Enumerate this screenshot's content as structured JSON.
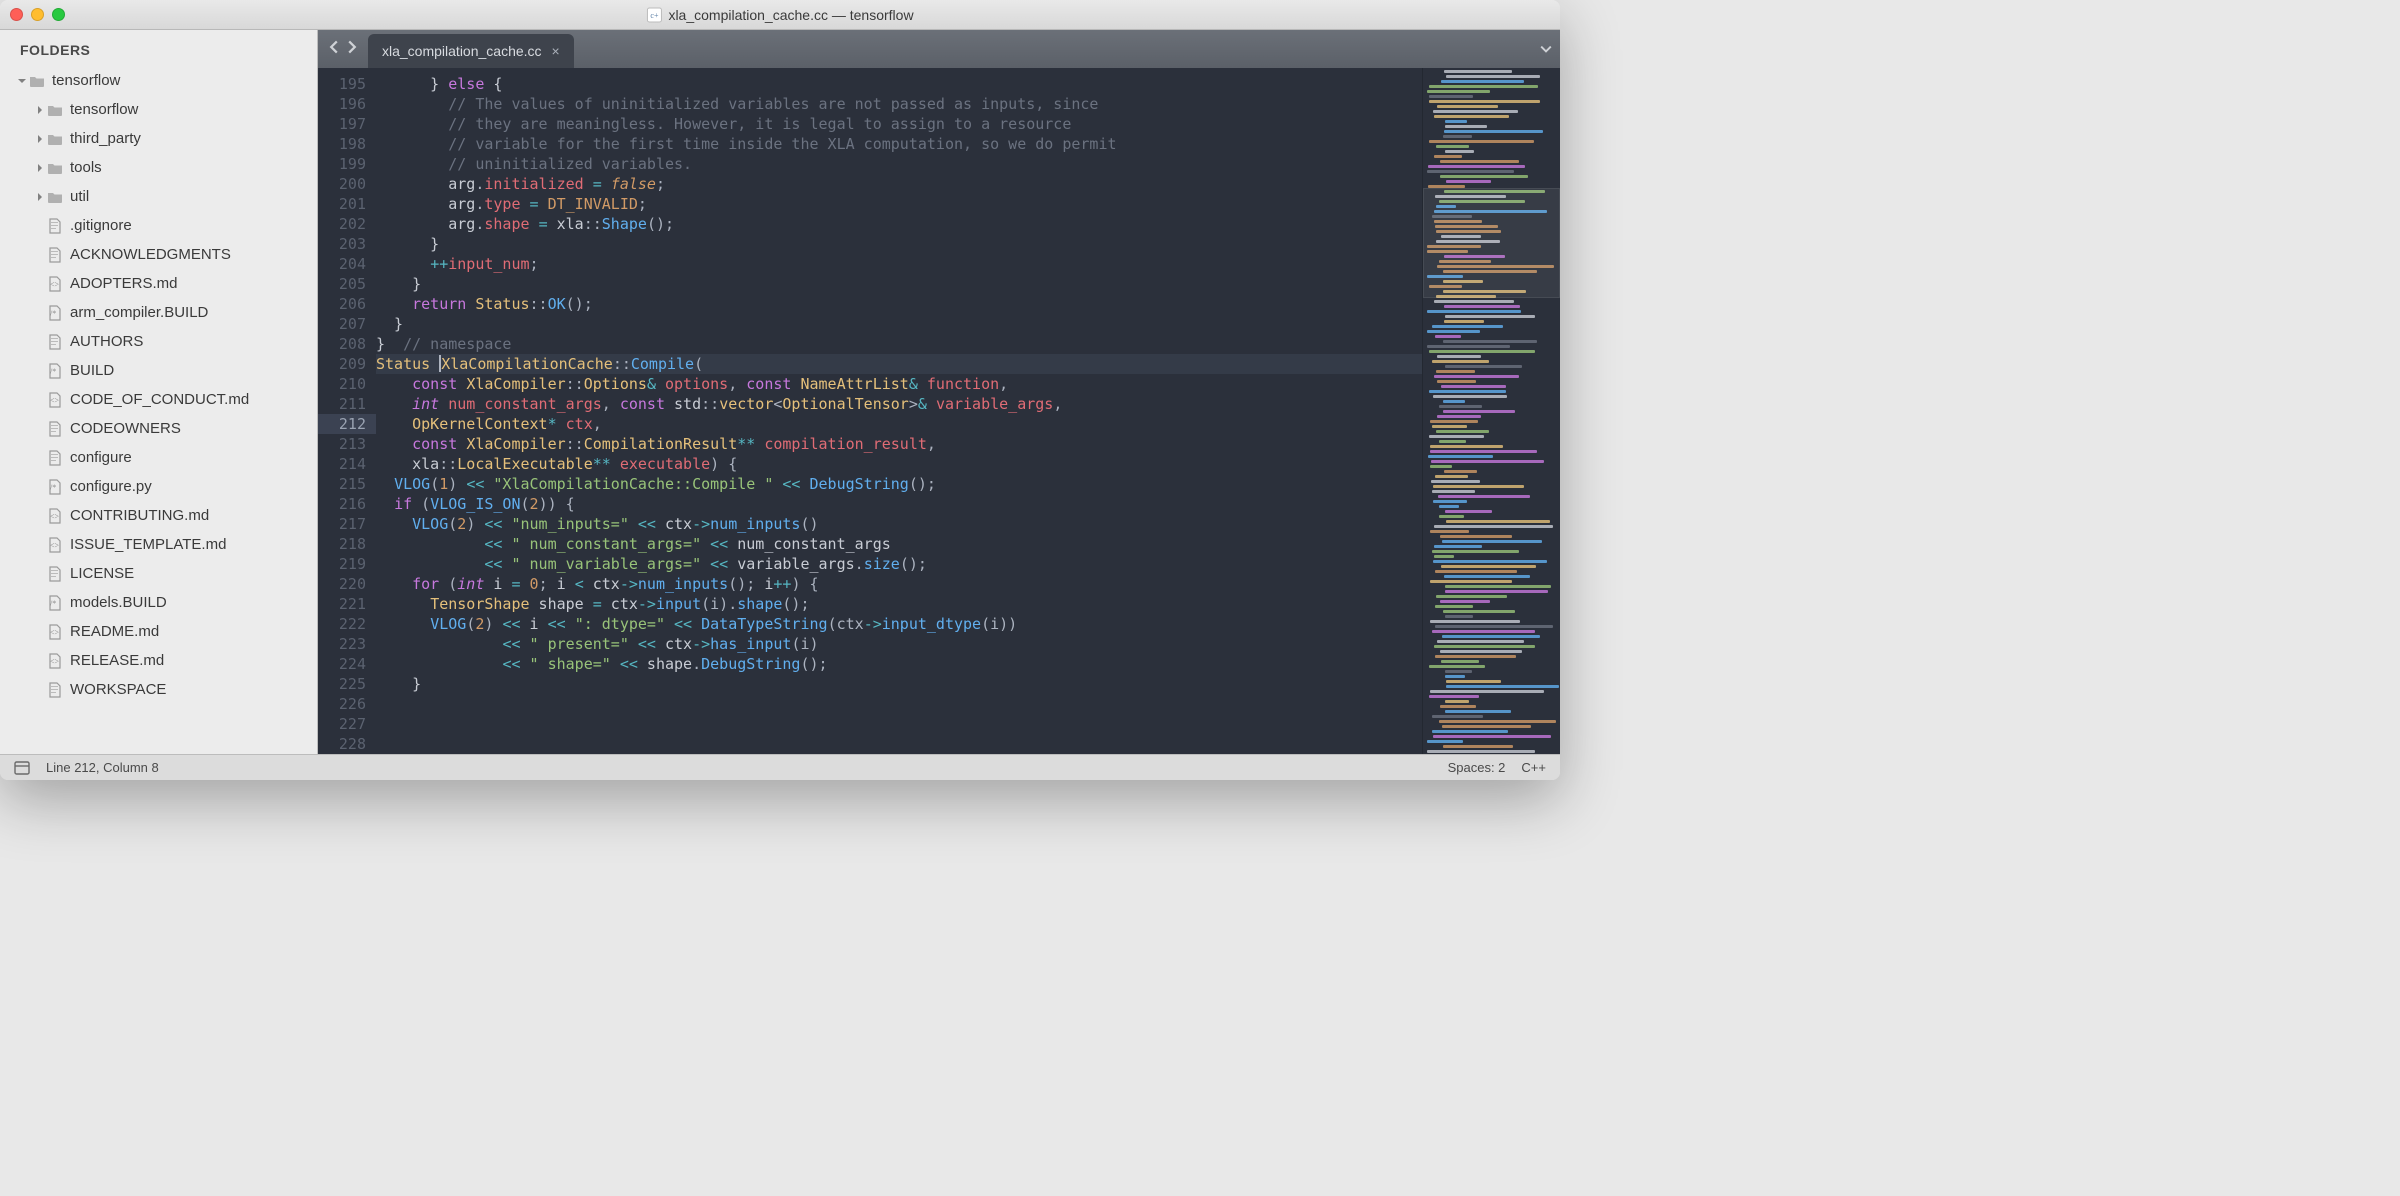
{
  "window": {
    "title": "xla_compilation_cache.cc — tensorflow"
  },
  "sidebar": {
    "header": "FOLDERS",
    "root": {
      "label": "tensorflow",
      "expanded": true,
      "folders": [
        {
          "label": "tensorflow"
        },
        {
          "label": "third_party"
        },
        {
          "label": "tools"
        },
        {
          "label": "util"
        }
      ],
      "files": [
        {
          "label": ".gitignore",
          "icon": "file"
        },
        {
          "label": "ACKNOWLEDGMENTS",
          "icon": "file"
        },
        {
          "label": "ADOPTERS.md",
          "icon": "md"
        },
        {
          "label": "arm_compiler.BUILD",
          "icon": "code"
        },
        {
          "label": "AUTHORS",
          "icon": "file"
        },
        {
          "label": "BUILD",
          "icon": "code"
        },
        {
          "label": "CODE_OF_CONDUCT.md",
          "icon": "md"
        },
        {
          "label": "CODEOWNERS",
          "icon": "file"
        },
        {
          "label": "configure",
          "icon": "file"
        },
        {
          "label": "configure.py",
          "icon": "code"
        },
        {
          "label": "CONTRIBUTING.md",
          "icon": "md"
        },
        {
          "label": "ISSUE_TEMPLATE.md",
          "icon": "md"
        },
        {
          "label": "LICENSE",
          "icon": "file"
        },
        {
          "label": "models.BUILD",
          "icon": "code"
        },
        {
          "label": "README.md",
          "icon": "md"
        },
        {
          "label": "RELEASE.md",
          "icon": "md"
        },
        {
          "label": "WORKSPACE",
          "icon": "file"
        }
      ]
    }
  },
  "tabs": {
    "active": {
      "label": "xla_compilation_cache.cc"
    }
  },
  "editor": {
    "first_line": 195,
    "highlight_line": 212,
    "lines": [
      [
        [
          "      } "
        ],
        [
          "kw",
          "else"
        ],
        [
          " {"
        ]
      ],
      [
        [
          "        "
        ],
        [
          "comm",
          "// The values of uninitialized variables are not passed as inputs, since"
        ]
      ],
      [
        [
          "        "
        ],
        [
          "comm",
          "// they are meaningless. However, it is legal to assign to a resource"
        ]
      ],
      [
        [
          "        "
        ],
        [
          "comm",
          "// variable for the first time inside the XLA computation, so we do permit"
        ]
      ],
      [
        [
          "        "
        ],
        [
          "comm",
          "// uninitialized variables."
        ]
      ],
      [
        [
          "        arg"
        ],
        [
          "punc",
          "."
        ],
        [
          "var",
          "initialized"
        ],
        [
          " "
        ],
        [
          "op",
          "="
        ],
        [
          " "
        ],
        [
          "boolf",
          "false"
        ],
        [
          "punc",
          ";"
        ]
      ],
      [
        [
          "        arg"
        ],
        [
          "punc",
          "."
        ],
        [
          "var",
          "type"
        ],
        [
          " "
        ],
        [
          "op",
          "="
        ],
        [
          " "
        ],
        [
          "const",
          "DT_INVALID"
        ],
        [
          "punc",
          ";"
        ]
      ],
      [
        [
          "        arg"
        ],
        [
          "punc",
          "."
        ],
        [
          "var",
          "shape"
        ],
        [
          " "
        ],
        [
          "op",
          "="
        ],
        [
          " xla"
        ],
        [
          "punc",
          "::"
        ],
        [
          "fn",
          "Shape"
        ],
        [
          "punc",
          "();"
        ]
      ],
      [
        [
          "      }"
        ]
      ],
      [
        [
          "      "
        ],
        [
          "op",
          "++"
        ],
        [
          "var",
          "input_num"
        ],
        [
          "punc",
          ";"
        ]
      ],
      [
        [
          "    }"
        ]
      ],
      [
        [
          ""
        ]
      ],
      [
        [
          "    "
        ],
        [
          "kw",
          "return"
        ],
        [
          " "
        ],
        [
          "cls",
          "Status"
        ],
        [
          "punc",
          "::"
        ],
        [
          "fn",
          "OK"
        ],
        [
          "punc",
          "();"
        ]
      ],
      [
        [
          "  }"
        ]
      ],
      [
        [
          ""
        ]
      ],
      [
        [
          "}  "
        ],
        [
          "comm",
          "// namespace"
        ]
      ],
      [
        [
          ""
        ]
      ],
      [
        [
          "cls",
          "Status"
        ],
        [
          " "
        ],
        [
          "CURSOR"
        ],
        [
          "cls",
          "XlaCompilationCache"
        ],
        [
          "punc",
          "::"
        ],
        [
          "fn",
          "Compile"
        ],
        [
          "punc",
          "("
        ]
      ],
      [
        [
          "    "
        ],
        [
          "kw",
          "const"
        ],
        [
          " "
        ],
        [
          "cls",
          "XlaCompiler"
        ],
        [
          "punc",
          "::"
        ],
        [
          "cls",
          "Options"
        ],
        [
          "op",
          "&"
        ],
        [
          " "
        ],
        [
          "var",
          "options"
        ],
        [
          "punc",
          ", "
        ],
        [
          "kw",
          "const"
        ],
        [
          " "
        ],
        [
          "cls",
          "NameAttrList"
        ],
        [
          "op",
          "&"
        ],
        [
          " "
        ],
        [
          "var",
          "function"
        ],
        [
          "punc",
          ","
        ]
      ],
      [
        [
          "    "
        ],
        [
          "type",
          "int"
        ],
        [
          " "
        ],
        [
          "var",
          "num_constant_args"
        ],
        [
          "punc",
          ", "
        ],
        [
          "kw",
          "const"
        ],
        [
          " std"
        ],
        [
          "punc",
          "::"
        ],
        [
          "cls",
          "vector"
        ],
        [
          "punc",
          "<"
        ],
        [
          "cls",
          "OptionalTensor"
        ],
        [
          "punc",
          ">"
        ],
        [
          "op",
          "&"
        ],
        [
          " "
        ],
        [
          "var",
          "variable_args"
        ],
        [
          "punc",
          ","
        ]
      ],
      [
        [
          "    "
        ],
        [
          "cls",
          "OpKernelContext"
        ],
        [
          "op",
          "*"
        ],
        [
          " "
        ],
        [
          "var",
          "ctx"
        ],
        [
          "punc",
          ","
        ]
      ],
      [
        [
          "    "
        ],
        [
          "kw",
          "const"
        ],
        [
          " "
        ],
        [
          "cls",
          "XlaCompiler"
        ],
        [
          "punc",
          "::"
        ],
        [
          "cls",
          "CompilationResult"
        ],
        [
          "op",
          "**"
        ],
        [
          " "
        ],
        [
          "var",
          "compilation_result"
        ],
        [
          "punc",
          ","
        ]
      ],
      [
        [
          "    xla"
        ],
        [
          "punc",
          "::"
        ],
        [
          "cls",
          "LocalExecutable"
        ],
        [
          "op",
          "**"
        ],
        [
          " "
        ],
        [
          "var",
          "executable"
        ],
        [
          "punc",
          ") {"
        ]
      ],
      [
        [
          "  "
        ],
        [
          "fn",
          "VLOG"
        ],
        [
          "punc",
          "("
        ],
        [
          "num",
          "1"
        ],
        [
          "punc",
          ") "
        ],
        [
          "op",
          "<<"
        ],
        [
          " "
        ],
        [
          "str",
          "\"XlaCompilationCache::Compile \""
        ],
        [
          " "
        ],
        [
          "op",
          "<<"
        ],
        [
          " "
        ],
        [
          "fn",
          "DebugString"
        ],
        [
          "punc",
          "();"
        ]
      ],
      [
        [
          ""
        ]
      ],
      [
        [
          "  "
        ],
        [
          "kw",
          "if"
        ],
        [
          " "
        ],
        [
          "punc",
          "("
        ],
        [
          "fn",
          "VLOG_IS_ON"
        ],
        [
          "punc",
          "("
        ],
        [
          "num",
          "2"
        ],
        [
          "punc",
          ")) {"
        ]
      ],
      [
        [
          "    "
        ],
        [
          "fn",
          "VLOG"
        ],
        [
          "punc",
          "("
        ],
        [
          "num",
          "2"
        ],
        [
          "punc",
          ") "
        ],
        [
          "op",
          "<<"
        ],
        [
          " "
        ],
        [
          "str",
          "\"num_inputs=\""
        ],
        [
          " "
        ],
        [
          "op",
          "<<"
        ],
        [
          " ctx"
        ],
        [
          "op",
          "->"
        ],
        [
          "fn",
          "num_inputs"
        ],
        [
          "punc",
          "()"
        ]
      ],
      [
        [
          "            "
        ],
        [
          "op",
          "<<"
        ],
        [
          " "
        ],
        [
          "str",
          "\" num_constant_args=\""
        ],
        [
          " "
        ],
        [
          "op",
          "<<"
        ],
        [
          " num_constant_args"
        ]
      ],
      [
        [
          "            "
        ],
        [
          "op",
          "<<"
        ],
        [
          " "
        ],
        [
          "str",
          "\" num_variable_args=\""
        ],
        [
          " "
        ],
        [
          "op",
          "<<"
        ],
        [
          " variable_args"
        ],
        [
          "punc",
          "."
        ],
        [
          "fn",
          "size"
        ],
        [
          "punc",
          "();"
        ]
      ],
      [
        [
          "    "
        ],
        [
          "kw",
          "for"
        ],
        [
          " "
        ],
        [
          "punc",
          "("
        ],
        [
          "type",
          "int"
        ],
        [
          " i "
        ],
        [
          "op",
          "="
        ],
        [
          " "
        ],
        [
          "num",
          "0"
        ],
        [
          "punc",
          "; "
        ],
        [
          "i "
        ],
        [
          "op",
          "<"
        ],
        [
          " ctx"
        ],
        [
          "op",
          "->"
        ],
        [
          "fn",
          "num_inputs"
        ],
        [
          "punc",
          "(); "
        ],
        [
          "i"
        ],
        [
          "op",
          "++"
        ],
        [
          "punc",
          ") {"
        ]
      ],
      [
        [
          "      "
        ],
        [
          "cls",
          "TensorShape"
        ],
        [
          " shape "
        ],
        [
          "op",
          "="
        ],
        [
          " ctx"
        ],
        [
          "op",
          "->"
        ],
        [
          "fn",
          "input"
        ],
        [
          "punc",
          "(i)."
        ],
        [
          "fn",
          "shape"
        ],
        [
          "punc",
          "();"
        ]
      ],
      [
        [
          "      "
        ],
        [
          "fn",
          "VLOG"
        ],
        [
          "punc",
          "("
        ],
        [
          "num",
          "2"
        ],
        [
          "punc",
          ") "
        ],
        [
          "op",
          "<<"
        ],
        [
          " i "
        ],
        [
          "op",
          "<<"
        ],
        [
          " "
        ],
        [
          "str",
          "\": dtype=\""
        ],
        [
          " "
        ],
        [
          "op",
          "<<"
        ],
        [
          " "
        ],
        [
          "fn",
          "DataTypeString"
        ],
        [
          "punc",
          "(ctx"
        ],
        [
          "op",
          "->"
        ],
        [
          "fn",
          "input_dtype"
        ],
        [
          "punc",
          "(i))"
        ]
      ],
      [
        [
          "              "
        ],
        [
          "op",
          "<<"
        ],
        [
          " "
        ],
        [
          "str",
          "\" present=\""
        ],
        [
          " "
        ],
        [
          "op",
          "<<"
        ],
        [
          " ctx"
        ],
        [
          "op",
          "->"
        ],
        [
          "fn",
          "has_input"
        ],
        [
          "punc",
          "(i)"
        ]
      ],
      [
        [
          "              "
        ],
        [
          "op",
          "<<"
        ],
        [
          " "
        ],
        [
          "str",
          "\" shape=\""
        ],
        [
          " "
        ],
        [
          "op",
          "<<"
        ],
        [
          " shape"
        ],
        [
          "punc",
          "."
        ],
        [
          "fn",
          "DebugString"
        ],
        [
          "punc",
          "();"
        ]
      ],
      [
        [
          "    }"
        ]
      ]
    ]
  },
  "statusbar": {
    "position": "Line 212, Column 8",
    "spaces": "Spaces: 2",
    "syntax": "C++"
  }
}
